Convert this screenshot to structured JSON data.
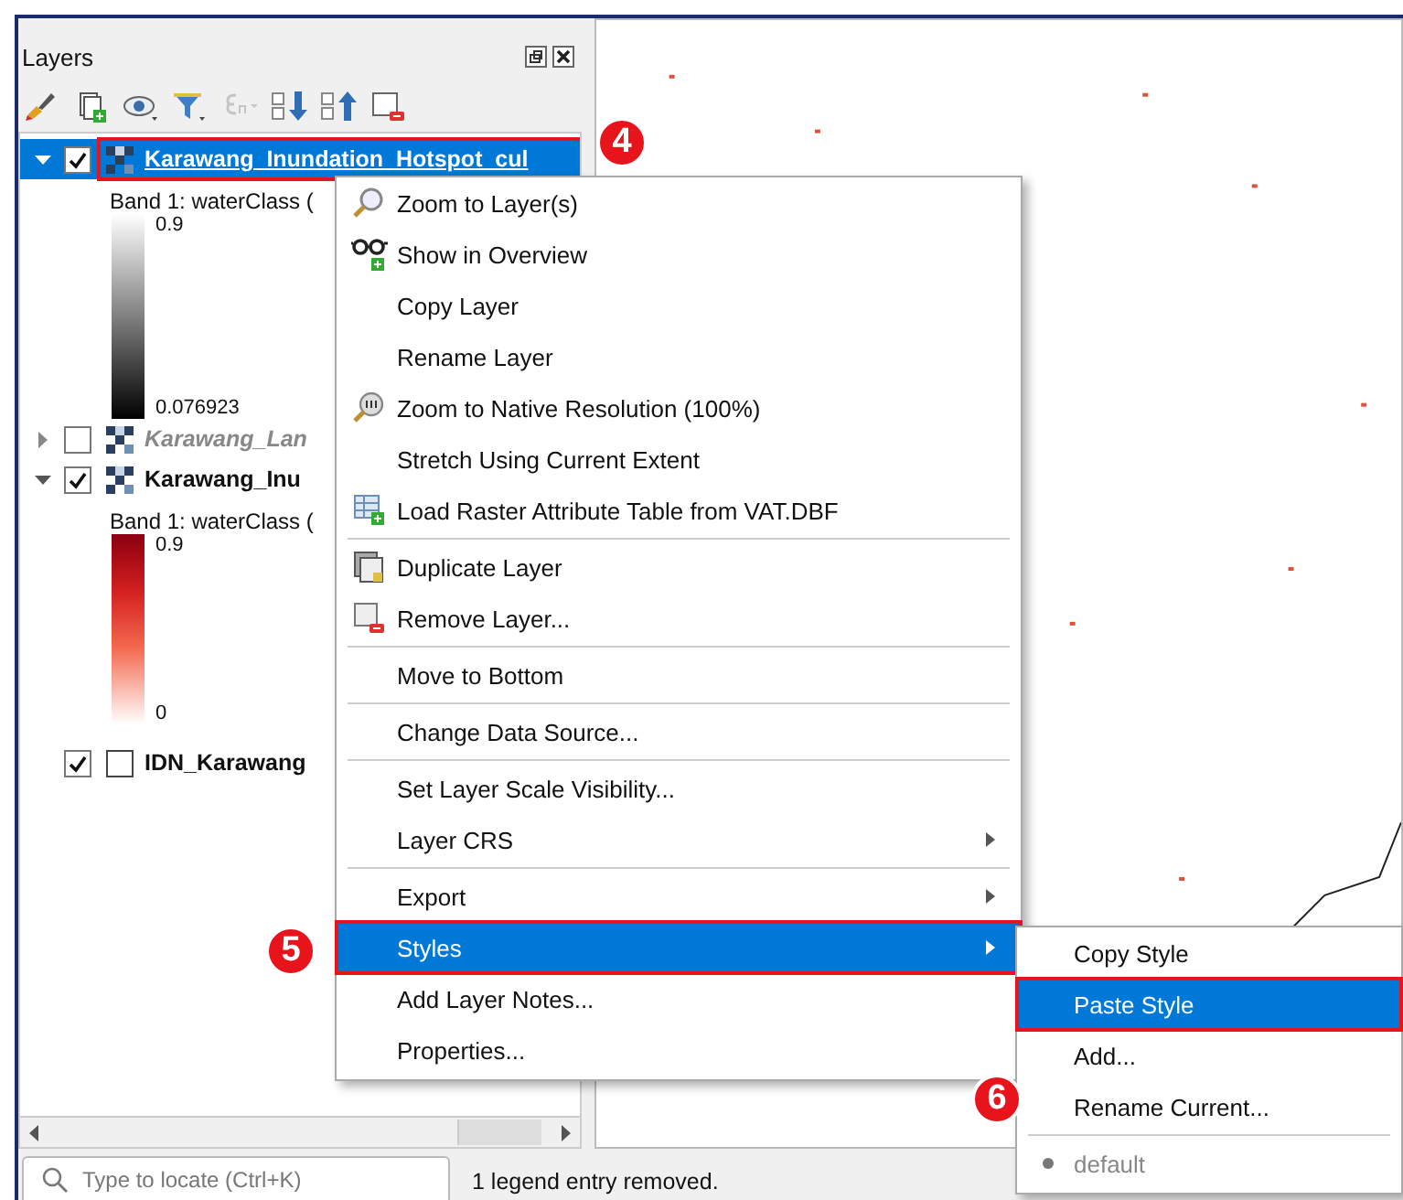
{
  "panel": {
    "title": "Layers"
  },
  "toolbar_buttons": [
    {
      "disabled": false
    },
    {
      "disabled": false
    },
    {
      "disabled": false
    },
    {
      "disabled": false
    },
    {
      "disabled": true
    },
    {
      "disabled": false
    },
    {
      "disabled": false
    },
    {
      "disabled": false
    }
  ],
  "layers": [
    {
      "name": "Karawang_Inundation_Hotspot_cul",
      "kind": "raster",
      "checked": true,
      "expanded": true,
      "selected": true,
      "disabled": false,
      "annotated": true,
      "legend": {
        "band": "Band 1: waterClass (",
        "max": "0.9",
        "min": "0.076923",
        "kind": "grayscale"
      }
    },
    {
      "name": "Karawang_Lan",
      "kind": "raster",
      "checked": false,
      "expanded": false,
      "selected": false,
      "disabled": true,
      "annotated": false
    },
    {
      "name": "Karawang_Inu",
      "kind": "raster",
      "checked": true,
      "expanded": true,
      "selected": false,
      "disabled": false,
      "annotated": false,
      "legend": {
        "band": "Band 1: waterClass (",
        "max": "0.9",
        "min": "0",
        "kind": "reds"
      }
    },
    {
      "name": "IDN_Karawang",
      "kind": "vector",
      "checked": true,
      "selected": false,
      "disabled": false,
      "annotated": false
    }
  ],
  "search": {
    "placeholder": "Type to locate (Ctrl+K)"
  },
  "status_bar": "1 legend entry removed.",
  "context_menu": [
    {
      "kind": "item",
      "label": "Zoom to Layer(s)",
      "submenu": false,
      "selected": false,
      "annotated": false
    },
    {
      "kind": "item",
      "label": "Show in Overview",
      "submenu": false,
      "selected": false,
      "annotated": false
    },
    {
      "kind": "item",
      "label": "Copy Layer",
      "submenu": false,
      "selected": false,
      "annotated": false
    },
    {
      "kind": "item",
      "label": "Rename Layer",
      "submenu": false,
      "selected": false,
      "annotated": false
    },
    {
      "kind": "item",
      "label": "Zoom to Native Resolution (100%)",
      "submenu": false,
      "selected": false,
      "annotated": false
    },
    {
      "kind": "item",
      "label": "Stretch Using Current Extent",
      "submenu": false,
      "selected": false,
      "annotated": false
    },
    {
      "kind": "item",
      "label": "Load Raster Attribute Table from VAT.DBF",
      "submenu": false,
      "selected": false,
      "annotated": false
    },
    {
      "kind": "separator"
    },
    {
      "kind": "item",
      "label": "Duplicate Layer",
      "submenu": false,
      "selected": false,
      "annotated": false
    },
    {
      "kind": "item",
      "label": "Remove Layer...",
      "submenu": false,
      "selected": false,
      "annotated": false
    },
    {
      "kind": "separator"
    },
    {
      "kind": "item",
      "label": "Move to Bottom",
      "submenu": false,
      "selected": false,
      "annotated": false
    },
    {
      "kind": "separator"
    },
    {
      "kind": "item",
      "label": "Change Data Source...",
      "submenu": false,
      "selected": false,
      "annotated": false
    },
    {
      "kind": "separator"
    },
    {
      "kind": "item",
      "label": "Set Layer Scale Visibility...",
      "submenu": false,
      "selected": false,
      "annotated": false
    },
    {
      "kind": "item",
      "label": "Layer CRS",
      "submenu": true,
      "selected": false,
      "annotated": false
    },
    {
      "kind": "separator"
    },
    {
      "kind": "item",
      "label": "Export",
      "submenu": true,
      "selected": false,
      "annotated": false
    },
    {
      "kind": "item",
      "label": "Styles",
      "submenu": true,
      "selected": true,
      "annotated": true
    },
    {
      "kind": "item",
      "label": "Add Layer Notes...",
      "submenu": false,
      "selected": false,
      "annotated": false
    },
    {
      "kind": "item",
      "label": "Properties...",
      "submenu": false,
      "selected": false,
      "annotated": false
    }
  ],
  "styles_submenu": [
    {
      "kind": "item",
      "label": "Copy Style",
      "selected": false,
      "annotated": false,
      "disabled": false,
      "checked": false
    },
    {
      "kind": "item",
      "label": "Paste Style",
      "selected": true,
      "annotated": true,
      "disabled": false,
      "checked": false
    },
    {
      "kind": "item",
      "label": "Add...",
      "selected": false,
      "annotated": false,
      "disabled": false,
      "checked": false
    },
    {
      "kind": "item",
      "label": "Rename Current...",
      "selected": false,
      "annotated": false,
      "disabled": false,
      "checked": false
    },
    {
      "kind": "separator"
    },
    {
      "kind": "item",
      "label": "default",
      "selected": false,
      "annotated": false,
      "disabled": true,
      "checked": true
    }
  ],
  "callouts": [
    "4",
    "5",
    "6"
  ]
}
